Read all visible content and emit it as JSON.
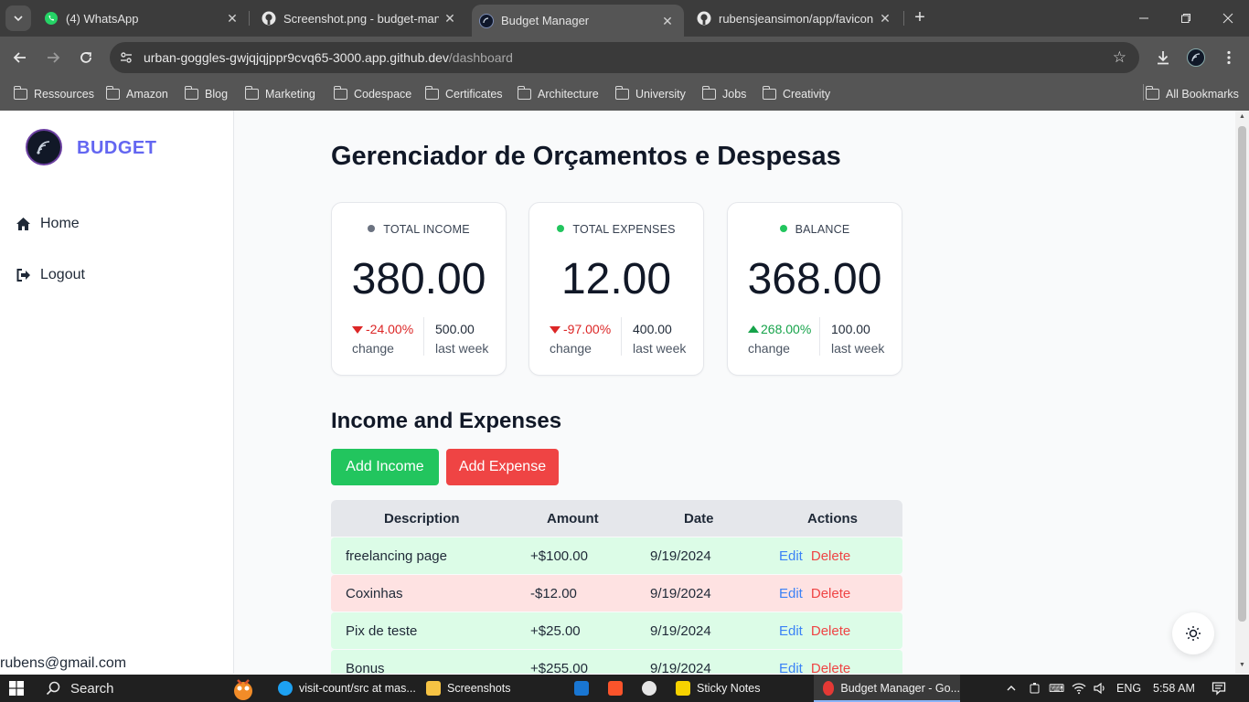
{
  "browser": {
    "tabs": [
      {
        "title": "(4) WhatsApp",
        "icon": "whatsapp-icon",
        "active": false
      },
      {
        "title": "Screenshot.png - budget-manag",
        "icon": "github-icon",
        "active": false
      },
      {
        "title": "Budget Manager",
        "icon": "app-favicon",
        "active": true
      },
      {
        "title": "rubensjeansimon/app/favicon.ic",
        "icon": "github-icon",
        "active": false
      }
    ],
    "url_host": "urban-goggles-gwjqjqjppr9cvq65-3000.app.github.dev",
    "url_path": "/dashboard",
    "bookmarks": [
      "Ressources",
      "Amazon",
      "Blog",
      "Marketing",
      "Codespace",
      "Certificates",
      "Architecture",
      "University",
      "Jobs",
      "Creativity"
    ],
    "all_bookmarks": "All Bookmarks"
  },
  "sidebar": {
    "brand": "BUDGET",
    "nav": [
      {
        "label": "Home",
        "icon": "home-icon"
      },
      {
        "label": "Logout",
        "icon": "logout-icon"
      }
    ],
    "user_email": "rubens@gmail.com"
  },
  "main": {
    "title": "Gerenciador de Orçamentos e Despesas",
    "cards": [
      {
        "label": "TOTAL INCOME",
        "dot_color": "#6b7280",
        "value": "380.00",
        "change": "-24.00%",
        "direction": "down",
        "change_caption": "change",
        "last_week_value": "500.00",
        "last_week_caption": "last week"
      },
      {
        "label": "TOTAL EXPENSES",
        "dot_color": "#22c55e",
        "value": "12.00",
        "change": "-97.00%",
        "direction": "down",
        "change_caption": "change",
        "last_week_value": "400.00",
        "last_week_caption": "last week"
      },
      {
        "label": "BALANCE",
        "dot_color": "#22c55e",
        "value": "368.00",
        "change": "268.00%",
        "direction": "up",
        "change_caption": "change",
        "last_week_value": "100.00",
        "last_week_caption": "last week"
      }
    ],
    "section_title": "Income and Expenses",
    "add_income_label": "Add Income",
    "add_expense_label": "Add Expense",
    "table": {
      "headers": [
        "Description",
        "Amount",
        "Date",
        "Actions"
      ],
      "edit_label": "Edit",
      "delete_label": "Delete",
      "rows": [
        {
          "description": "freelancing page",
          "amount": "+$100.00",
          "date": "9/19/2024",
          "type": "income"
        },
        {
          "description": "Coxinhas",
          "amount": "-$12.00",
          "date": "9/19/2024",
          "type": "expense"
        },
        {
          "description": "Pix de teste",
          "amount": "+$25.00",
          "date": "9/19/2024",
          "type": "income"
        },
        {
          "description": "Bonus",
          "amount": "+$255.00",
          "date": "9/19/2024",
          "type": "income"
        }
      ]
    }
  },
  "taskbar": {
    "search": "Search",
    "items": [
      "visit-count/src at mas...",
      "Screenshots",
      "Sticky Notes",
      "Budget Manager - Go..."
    ],
    "lang": "ENG",
    "time": "5:58 AM"
  },
  "colors": {
    "brand": "#6366f1",
    "income_green": "#22c55e",
    "expense_red": "#ef4444",
    "income_row": "#dcfce7",
    "expense_row": "#fee2e2"
  }
}
